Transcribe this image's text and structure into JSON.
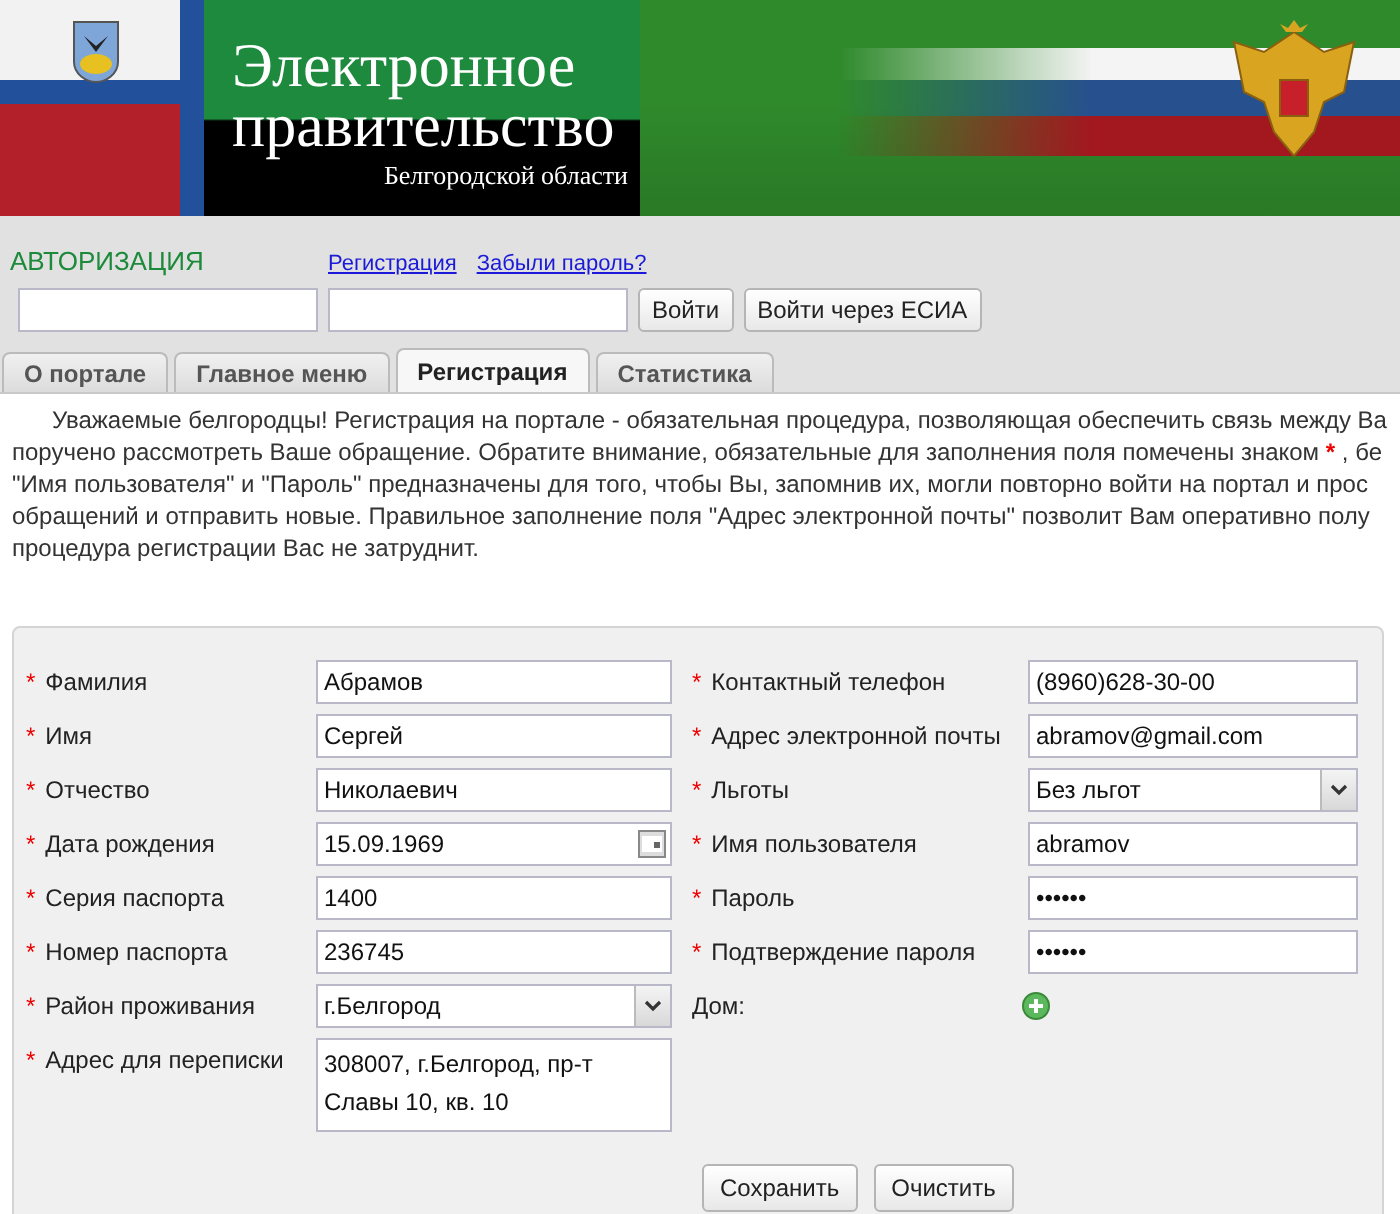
{
  "header": {
    "title_line1": "Электронное",
    "title_line2": "правительство",
    "subtitle": "Белгородской области"
  },
  "auth": {
    "heading": "АВТОРИЗАЦИЯ",
    "links": [
      "Регистрация",
      "Забыли пароль?"
    ],
    "buttons": [
      "Войти",
      "Войти через ЕСИА"
    ]
  },
  "tabs": [
    {
      "label": "О портале",
      "selected": false
    },
    {
      "label": "Главное меню",
      "selected": false
    },
    {
      "label": "Регистрация",
      "selected": true
    },
    {
      "label": "Статистика",
      "selected": false
    }
  ],
  "intro": [
    {
      "text": "Уважаемые белгородцы! Регистрация на портале - обязательная процедура, позволяющая обеспечить связь между Ва"
    },
    {
      "text": "поручено рассмотреть Ваше обращение. Обратите внимание, обязательные для заполнения поля помечены знаком",
      "mark": "*",
      "after": ", бе"
    },
    {
      "text": "\"Имя пользователя\" и \"Пароль\" предназначены для того, чтобы Вы, запомнив их, могли повторно войти на портал и прос"
    },
    {
      "text": "обращений и отправить новые. Правильное заполнение поля \"Адрес электронной почты\" позволит Вам оперативно полу"
    },
    {
      "text": "процедура регистрации Вас не затруднит."
    }
  ],
  "form": {
    "left": [
      {
        "label": "Фамилия",
        "required": true,
        "kind": "text",
        "value": "Абрамов"
      },
      {
        "label": "Имя",
        "required": true,
        "kind": "text",
        "value": "Сергей"
      },
      {
        "label": "Отчество",
        "required": true,
        "kind": "text",
        "value": "Николаевич"
      },
      {
        "label": "Дата рождения",
        "required": true,
        "kind": "date",
        "value": "15.09.1969"
      },
      {
        "label": "Серия паспорта",
        "required": true,
        "kind": "text",
        "value": "1400"
      },
      {
        "label": "Номер паспорта",
        "required": true,
        "kind": "text",
        "value": "236745"
      },
      {
        "label": "Район проживания",
        "required": true,
        "kind": "select",
        "value": "г.Белгород"
      },
      {
        "label": "Адрес для переписки",
        "required": true,
        "kind": "textarea",
        "value": "308007, г.Белгород, пр-т Славы 10, кв. 10"
      }
    ],
    "right": [
      {
        "label": "Контактный телефон",
        "required": true,
        "kind": "text",
        "value": "(8960)628-30-00"
      },
      {
        "label": "Адрес электронной почты",
        "required": true,
        "kind": "text",
        "value": "abramov@gmail.com"
      },
      {
        "label": "Льготы",
        "required": true,
        "kind": "select",
        "value": "Без льгот"
      },
      {
        "label": "Имя пользователя",
        "required": true,
        "kind": "text",
        "value": "abramov"
      },
      {
        "label": "Пароль",
        "required": true,
        "kind": "password",
        "value": "••••••"
      },
      {
        "label": "Подтверждение пароля",
        "required": true,
        "kind": "password",
        "value": "••••••"
      },
      {
        "label": "Дом:",
        "required": false,
        "kind": "add"
      }
    ],
    "buttons": [
      "Сохранить",
      "Очистить"
    ]
  }
}
